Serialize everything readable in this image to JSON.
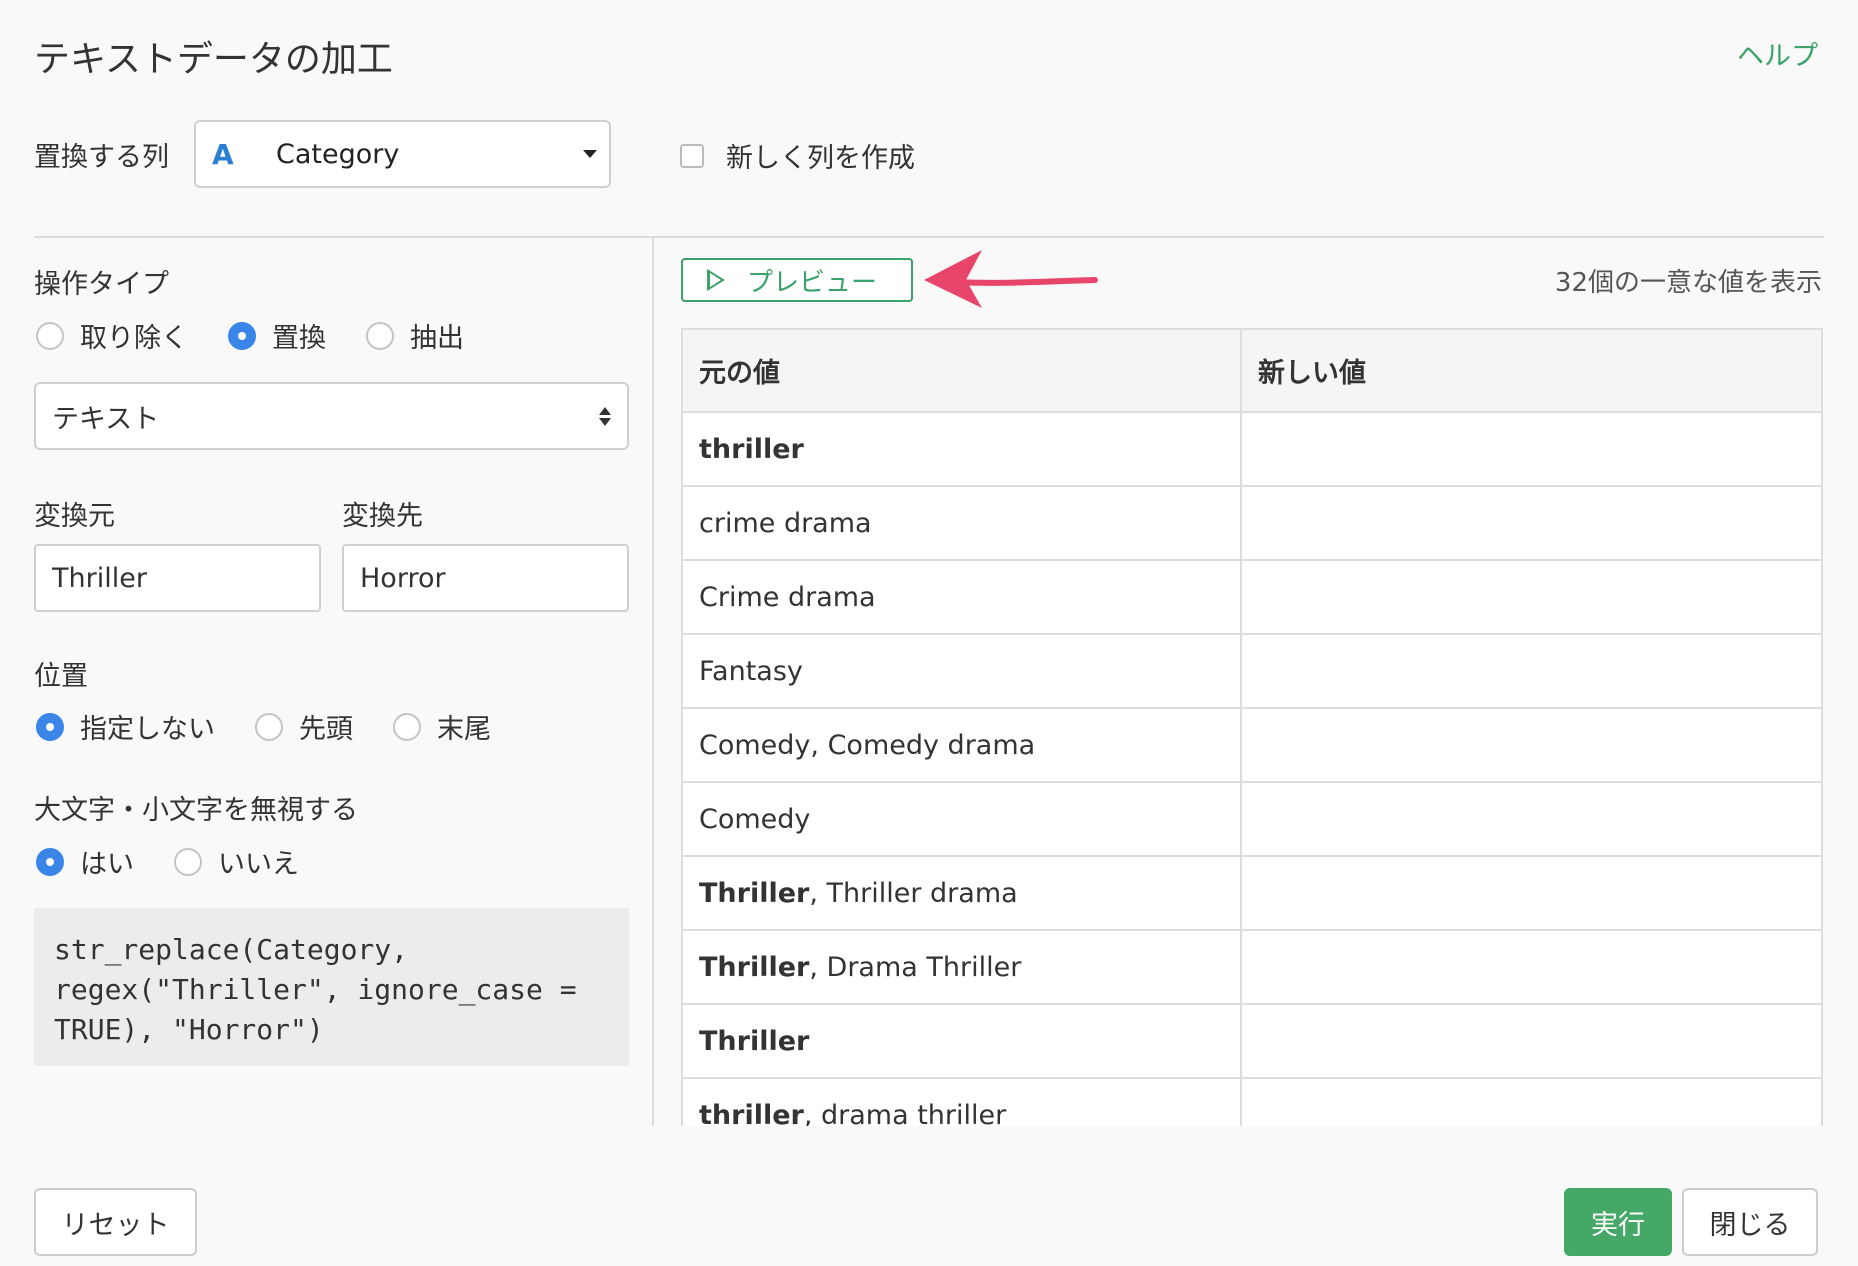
{
  "header": {
    "title": "テキストデータの加工",
    "help": "ヘルプ"
  },
  "column": {
    "label": "置換する列",
    "type_icon": "A",
    "selected": "Category"
  },
  "new_column": {
    "label": "新しく列を作成",
    "checked": false
  },
  "operation": {
    "label": "操作タイプ",
    "options": [
      "取り除く",
      "置換",
      "抽出"
    ],
    "selected": "置換"
  },
  "match_type": {
    "selected": "テキスト"
  },
  "from": {
    "label": "変換元",
    "value": "Thriller"
  },
  "to": {
    "label": "変換先",
    "value": "Horror"
  },
  "position": {
    "label": "位置",
    "options": [
      "指定しない",
      "先頭",
      "末尾"
    ],
    "selected": "指定しない"
  },
  "ignore_case": {
    "label": "大文字・小文字を無視する",
    "options": [
      "はい",
      "いいえ"
    ],
    "selected": "はい"
  },
  "code": "str_replace(Category,\nregex(\"Thriller\", ignore_case =\nTRUE), \"Horror\")",
  "preview": {
    "button": "プレビュー",
    "unique_info": "32個の一意な値を表示"
  },
  "table": {
    "headers": [
      "元の値",
      "新しい値"
    ],
    "rows": [
      {
        "bold": "thriller",
        "rest": "",
        "new": ""
      },
      {
        "bold": "",
        "rest": "crime drama",
        "new": ""
      },
      {
        "bold": "",
        "rest": "Crime drama",
        "new": ""
      },
      {
        "bold": "",
        "rest": "Fantasy",
        "new": ""
      },
      {
        "bold": "",
        "rest": "Comedy, Comedy drama",
        "new": ""
      },
      {
        "bold": "",
        "rest": "Comedy",
        "new": ""
      },
      {
        "bold": "Thriller",
        "rest": ", Thriller drama",
        "new": ""
      },
      {
        "bold": "Thriller",
        "rest": ", Drama Thriller",
        "new": ""
      },
      {
        "bold": "Thriller",
        "rest": "",
        "new": ""
      },
      {
        "bold": "thriller",
        "rest": ", drama thriller",
        "new": ""
      }
    ]
  },
  "footer": {
    "reset": "リセット",
    "run": "実行",
    "close": "閉じる"
  },
  "colors": {
    "accent_green": "#46a866",
    "radio_blue": "#3a86e8",
    "arrow_pink": "#e8456b"
  }
}
